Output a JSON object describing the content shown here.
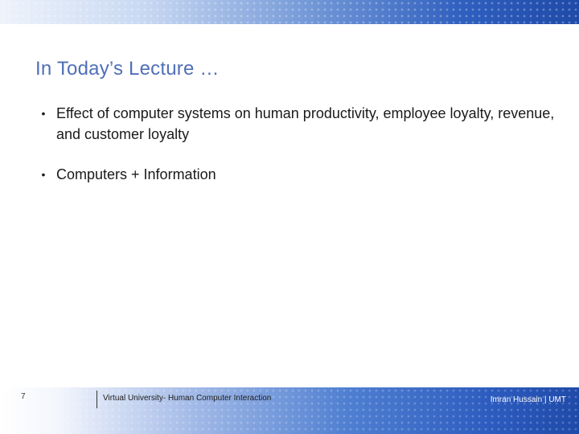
{
  "slide": {
    "title": "In Today’s Lecture …",
    "bullets": [
      {
        "marker": "•",
        "text": "Effect of computer systems on human productivity, employee loyalty, revenue, and customer loyalty"
      },
      {
        "marker": "•",
        "text": "Computers + Information"
      }
    ]
  },
  "footer": {
    "page_number": "7",
    "course": "Virtual University- Human Computer Interaction",
    "author": "Imran Hussain | UMT"
  },
  "colors": {
    "title": "#4f6fb8",
    "banner_dark": "#1f4aa8",
    "banner_light": "#eef3fb"
  }
}
